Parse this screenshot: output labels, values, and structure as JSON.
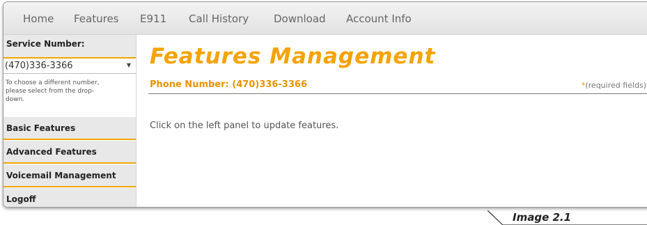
{
  "nav": {
    "items": [
      "Home",
      "Features",
      "E911",
      "Call History",
      "Download",
      "Account Info"
    ]
  },
  "sidebar": {
    "service_number_label": "Service Number:",
    "selected_number": "(470)336-3366",
    "help_text_line1": "To choose a different number,",
    "help_text_line2": "please select from the drop-",
    "help_text_line3": "down.",
    "menu_items": [
      "Basic Features",
      "Advanced Features",
      "Voicemail Management",
      "Logoff"
    ]
  },
  "main": {
    "title": "Features Management",
    "phone_number_label": "Phone Number: (470)336-3366",
    "required_star": "*",
    "required_text": "(required fields)",
    "hint": "Click on the left panel to update features."
  },
  "caption": "Image 2.1",
  "colors": {
    "accent": "#f5a300",
    "accent_dark": "#e79400"
  }
}
